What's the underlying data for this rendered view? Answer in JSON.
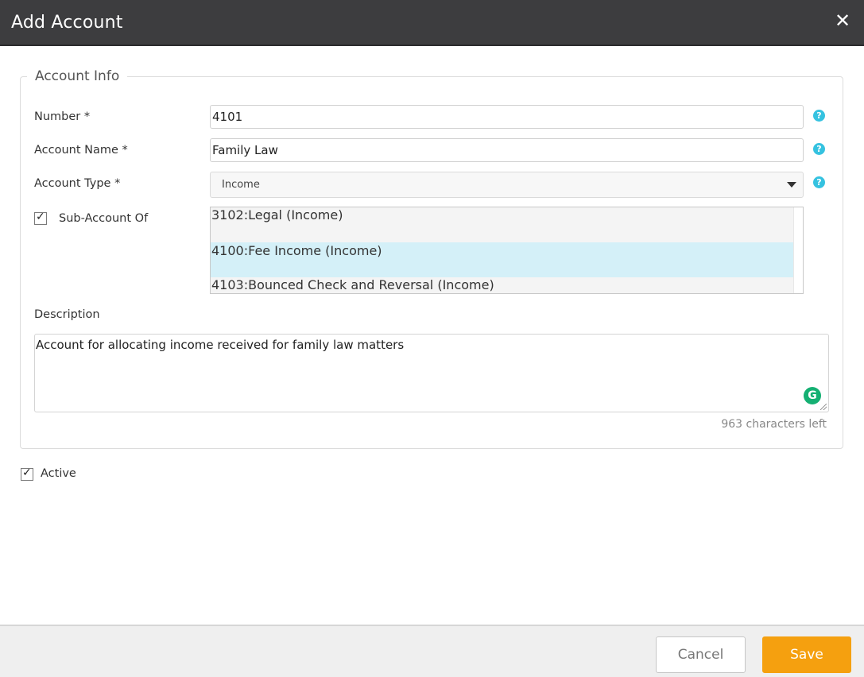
{
  "dialog": {
    "title": "Add Account",
    "close_icon": "close-icon"
  },
  "section": {
    "title": "Account Info"
  },
  "fields": {
    "number": {
      "label": "Number *",
      "value": "4101"
    },
    "account_name": {
      "label": "Account Name *",
      "value": "Family Law"
    },
    "account_type": {
      "label": "Account Type *",
      "value": "Income"
    },
    "sub_account": {
      "label": "Sub-Account Of",
      "checked": true,
      "options": [
        {
          "label": "3102:Legal (Income)",
          "selected": false
        },
        {
          "label": "4100:Fee Income (Income)",
          "selected": true
        },
        {
          "label": "4103:Bounced Check and Reversal (Income)",
          "selected": false
        }
      ]
    },
    "description": {
      "label": "Description",
      "value": "Account for allocating income received for family law matters",
      "chars_left": "963 characters left"
    },
    "active": {
      "label": "Active",
      "checked": true
    }
  },
  "help_icon": "question-mark",
  "footer": {
    "cancel_label": "Cancel",
    "save_label": "Save"
  },
  "colors": {
    "title_bar": "#3d3d3f",
    "help_icon": "#35c2e0",
    "selected_option": "#d4f0f8",
    "save_button": "#f5a00f",
    "grammarly": "#15b073"
  }
}
